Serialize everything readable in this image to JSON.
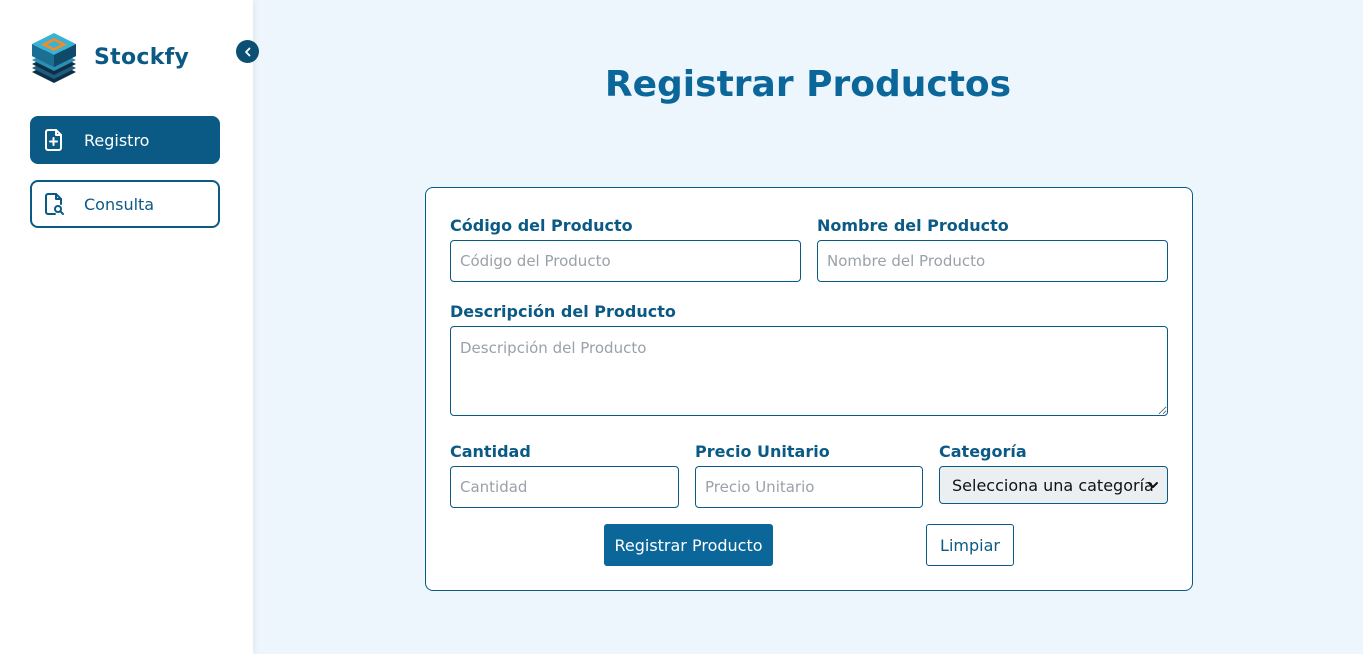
{
  "brand": {
    "name": "Stockfy"
  },
  "sidebar": {
    "items": [
      {
        "label": "Registro",
        "icon": "file-plus-icon",
        "active": true
      },
      {
        "label": "Consulta",
        "icon": "file-search-icon",
        "active": false
      }
    ]
  },
  "page": {
    "title": "Registrar Productos"
  },
  "form": {
    "codigo": {
      "label": "Código del Producto",
      "placeholder": "Código del Producto",
      "value": ""
    },
    "nombre": {
      "label": "Nombre del Producto",
      "placeholder": "Nombre del Producto",
      "value": ""
    },
    "descripcion": {
      "label": "Descripción del Producto",
      "placeholder": "Descripción del Producto",
      "value": ""
    },
    "cantidad": {
      "label": "Cantidad",
      "placeholder": "Cantidad",
      "value": ""
    },
    "precio": {
      "label": "Precio Unitario",
      "placeholder": "Precio Unitario",
      "value": ""
    },
    "categoria": {
      "label": "Categoría",
      "selected": "Selecciona una categoría"
    },
    "submit_label": "Registrar Producto",
    "clear_label": "Limpiar"
  },
  "colors": {
    "primary": "#0b5a85",
    "accent": "#0b6699",
    "background": "#eef6fd"
  }
}
